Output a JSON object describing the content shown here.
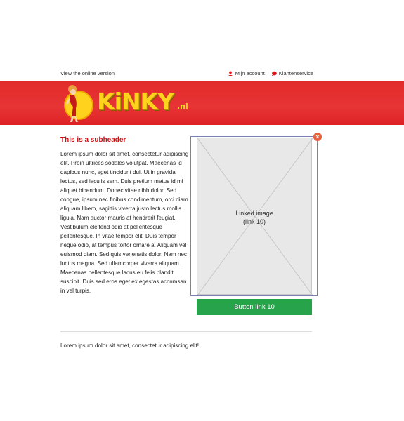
{
  "topbar": {
    "view_online": "View the online version",
    "account_label": "Mijn account",
    "service_label": "Klantenservice"
  },
  "header": {
    "logo_word": "KiNKY",
    "logo_suffix": ".nl"
  },
  "content": {
    "subheader": "This is a subheader",
    "paragraph": "Lorem ipsum dolor sit amet, consectetur adipiscing elit. Proin ultrices sodales volutpat. Maecenas id dapibus nunc, eget tincidunt dui. Ut in gravida lectus, sed iaculis sem. Duis pretium metus id mi aliquet bibendum. Donec vitae nibh dolor. Sed congue, ipsum nec finibus condimentum, orci diam aliquam libero, sagittis viverra justo lectus mollis ligula. Nam auctor mauris at hendrerit feugiat. Vestibulum eleifend odio at pellentesque pellentesque. In vitae tempor elit. Duis tempor neque odio, at tempus tortor ornare a. Aliquam vel euismod diam. Sed quis venenatis dolor. Nam nec luctus magna. Sed ullamcorper viverra aliquam. Maecenas pellentesque lacus eu felis blandit suscipit. Duis sed eros eget ex egestas accumsan in vel turpis.",
    "image_line1": "Linked image",
    "image_line2": "(link 10)",
    "button_label": "Button link 10",
    "footer_text": "Lorem ipsum dolor sit amet, consectetur adipiscing elit!"
  },
  "colors": {
    "banner_red": "#e42b2c",
    "subheader_red": "#d00e12",
    "button_green": "#27a44b",
    "logo_yellow": "#ffd21d",
    "close_orange": "#e8613d"
  },
  "icons": {
    "account": "user-icon",
    "service": "chat-bubble-icon",
    "close": "close-icon"
  }
}
